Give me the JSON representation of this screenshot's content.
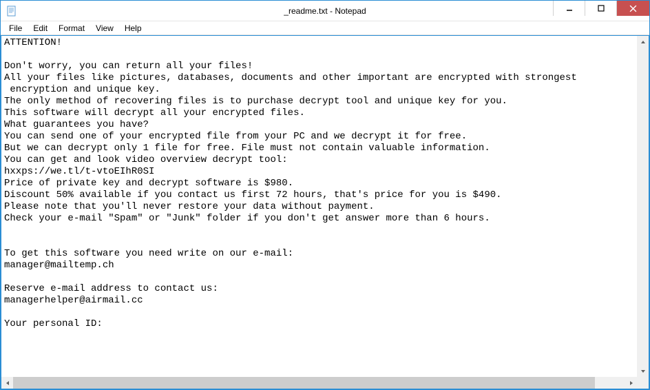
{
  "window": {
    "title": "_readme.txt - Notepad"
  },
  "menu": {
    "file": "File",
    "edit": "Edit",
    "format": "Format",
    "view": "View",
    "help": "Help"
  },
  "content": {
    "text": "ATTENTION!\n\nDon't worry, you can return all your files!\nAll your files like pictures, databases, documents and other important are encrypted with strongest\n encryption and unique key.\nThe only method of recovering files is to purchase decrypt tool and unique key for you.\nThis software will decrypt all your encrypted files.\nWhat guarantees you have?\nYou can send one of your encrypted file from your PC and we decrypt it for free.\nBut we can decrypt only 1 file for free. File must not contain valuable information.\nYou can get and look video overview decrypt tool:\nhxxps://we.tl/t-vtoEIhR0SI\nPrice of private key and decrypt software is $980.\nDiscount 50% available if you contact us first 72 hours, that's price for you is $490.\nPlease note that you'll never restore your data without payment.\nCheck your e-mail \"Spam\" or \"Junk\" folder if you don't get answer more than 6 hours.\n\n\nTo get this software you need write on our e-mail:\nmanager@mailtemp.ch\n\nReserve e-mail address to contact us:\nmanagerhelper@airmail.cc\n\nYour personal ID:"
  }
}
